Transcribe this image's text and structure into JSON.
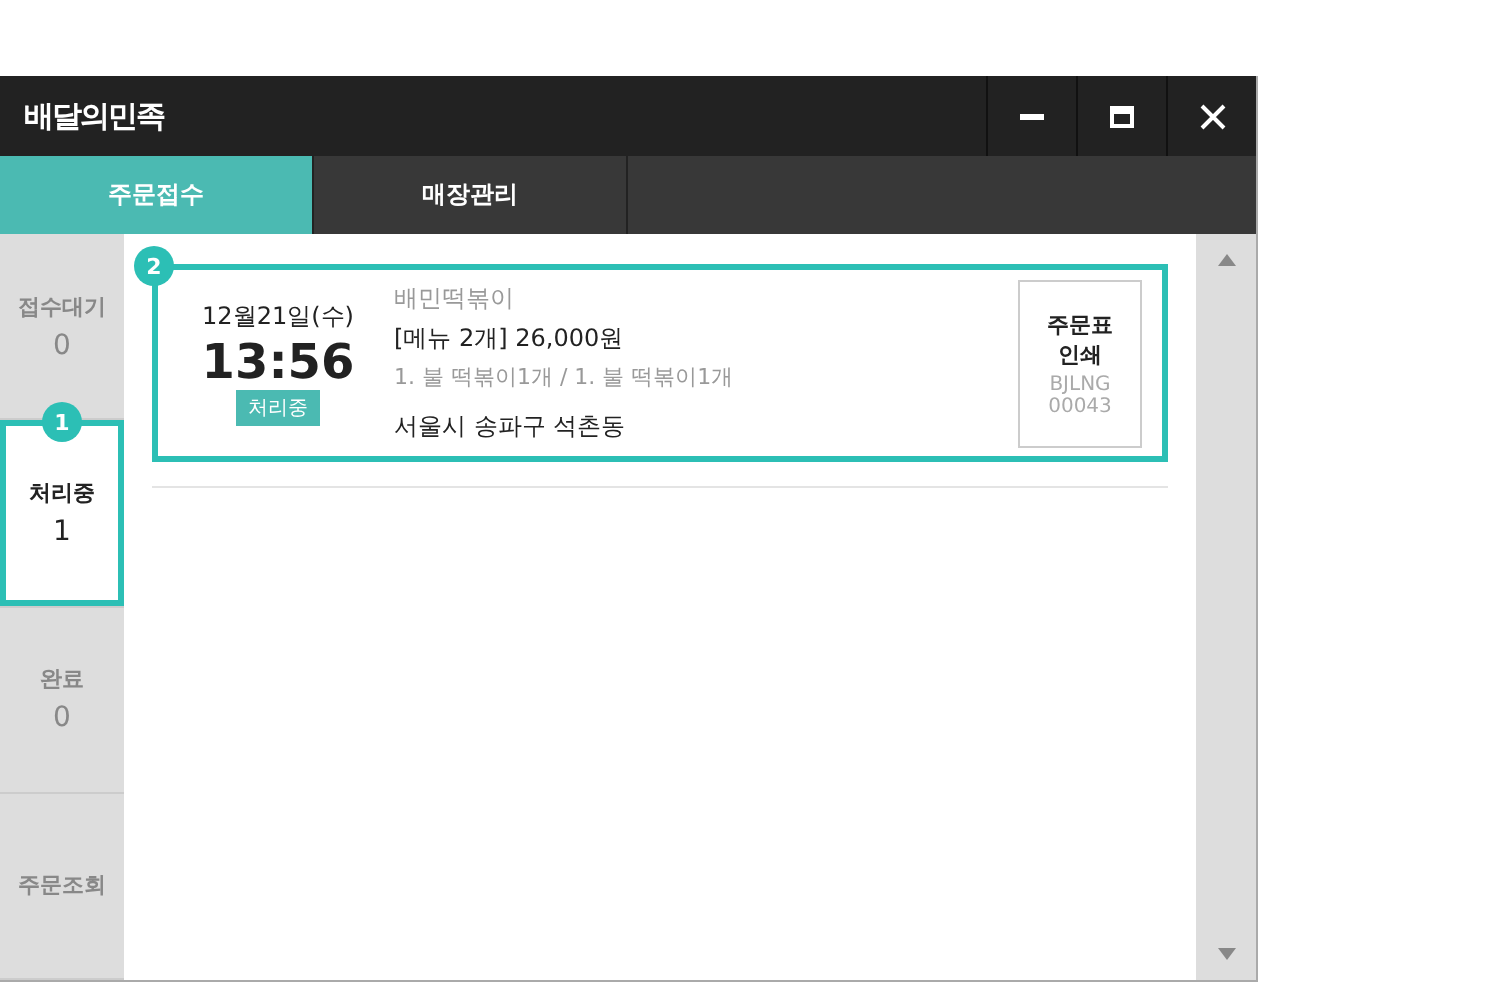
{
  "window": {
    "title": "배달의민족"
  },
  "tabs": [
    {
      "label": "주문접수",
      "selected": true
    },
    {
      "label": "매장관리",
      "selected": false
    }
  ],
  "sidebar": {
    "items": [
      {
        "label": "접수대기",
        "count": "0",
        "selected": false
      },
      {
        "label": "처리중",
        "count": "1",
        "selected": true,
        "callout": "1"
      },
      {
        "label": "완료",
        "count": "0",
        "selected": false
      },
      {
        "label": "주문조회",
        "selected": false
      }
    ]
  },
  "orders": [
    {
      "callout": "2",
      "date": "12월21일(수)",
      "time": "13:56",
      "status": "처리중",
      "store": "배민떡볶이",
      "summary": "[메뉴 2개] 26,000원",
      "items": "1. 불 떡볶이1개 / 1. 불 떡볶이1개",
      "address": "서울시 송파구 석촌동",
      "print_label": "주문표\n인쇄",
      "order_code": "BJLNG\n00043"
    }
  ]
}
